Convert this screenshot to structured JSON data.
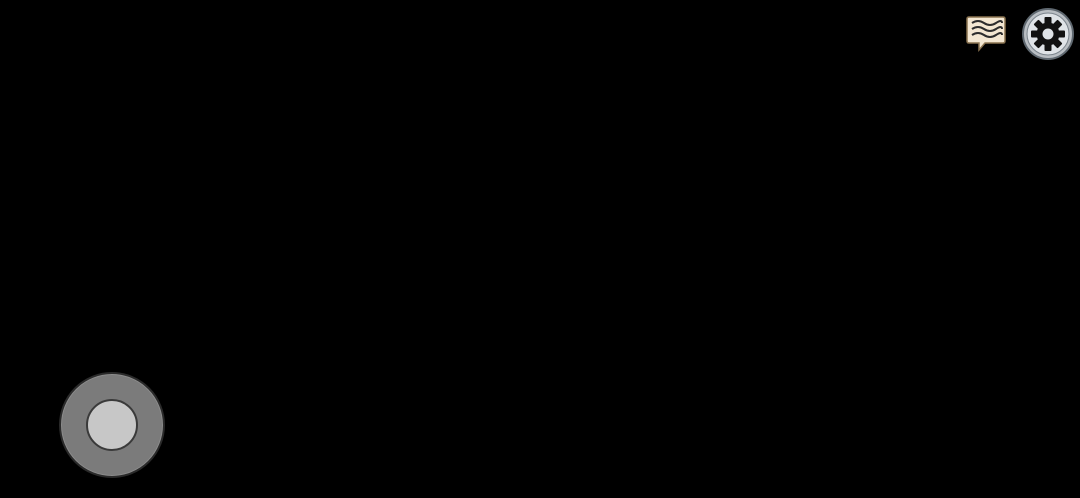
{
  "screen": {
    "background_color": "#000000"
  },
  "top_controls": {
    "chat_icon": "chat-bubble-icon",
    "settings_icon": "gear-icon"
  },
  "joystick": {
    "base_color": "#7b7b7b",
    "knob_color": "#c7c7c7"
  }
}
